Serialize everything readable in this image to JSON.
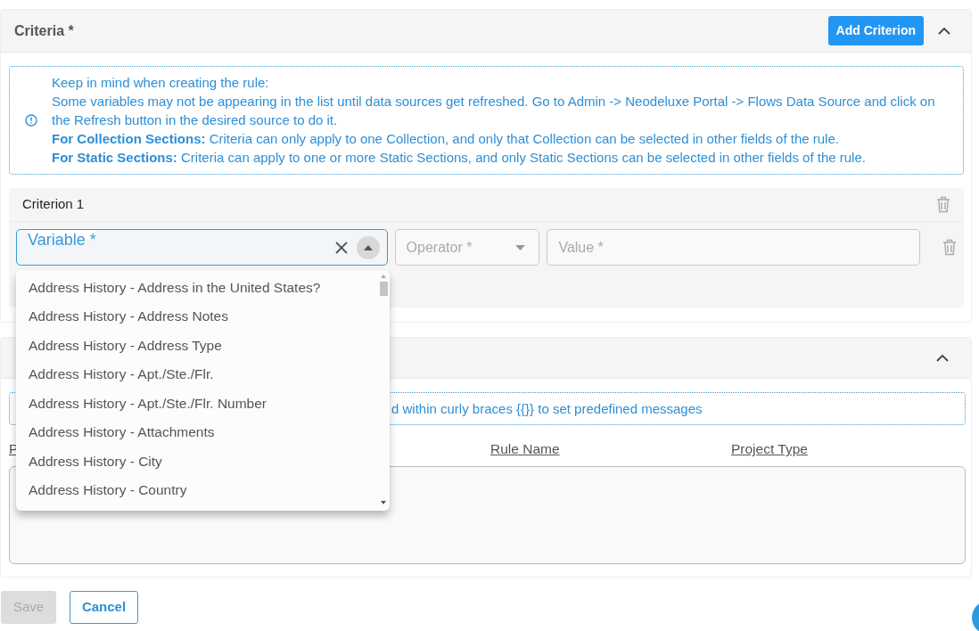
{
  "criteria_section": {
    "title": "Criteria *",
    "add_button": "Add Criterion",
    "expanded": true
  },
  "info": {
    "lines": [
      "Keep in mind when creating the rule:",
      "Some variables may not be appearing in the list until data sources get refreshed. Go to Admin -> Neodeluxe Portal -> Flows Data Source and click on the Refresh button in the desired source to do it.",
      "**For Collection Sections:**  Criteria can only apply to one Collection, and only that Collection can be selected in other fields of the rule.",
      "**For Static Sections:**  Criteria can apply to one or more Static Sections, and only Static Sections can be selected in other fields of the rule."
    ]
  },
  "criterion": {
    "title": "Criterion 1",
    "variable": {
      "label": "Variable *",
      "focused": true,
      "open": true
    },
    "operator": {
      "placeholder": "Operator *"
    },
    "value": {
      "placeholder": "Value *"
    }
  },
  "variable_options": [
    "Address History - Address in the United States?",
    "Address History - Address Notes",
    "Address History - Address Type",
    "Address History - Apt./Ste./Flr.",
    "Address History - Apt./Ste./Flr. Number",
    "Address History - Attachments",
    "Address History - City",
    "Address History - Country"
  ],
  "messages_section": {
    "expanded": true,
    "info": "d within curly braces {{}} to set predefined messages",
    "columns": [
      "P",
      "Rule Name",
      "Project Type"
    ]
  },
  "buttons": [
    {
      "label": "Save",
      "disabled": true
    },
    {
      "label": "Cancel",
      "disabled": false
    }
  ]
}
